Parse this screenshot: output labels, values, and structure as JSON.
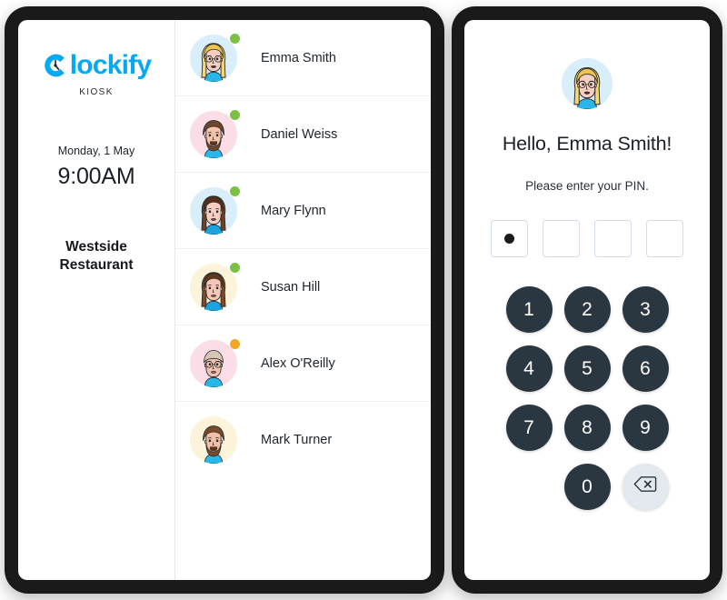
{
  "brand": {
    "name": "lockify",
    "logo_icon": "clockify-clock-logo-icon",
    "subtitle": "KIOSK",
    "accent_color": "#03A9F4"
  },
  "clock": {
    "date": "Monday, 1 May",
    "time": "9:00AM"
  },
  "location": {
    "name": "Westside Restaurant"
  },
  "status_colors": {
    "online": "#7ac143",
    "away": "#f5a623"
  },
  "users": [
    {
      "name": "Emma Smith",
      "status": "online",
      "avatar_icon": "avatar-emma-smith",
      "avatar_bg": "#d8eefb"
    },
    {
      "name": "Daniel Weiss",
      "status": "online",
      "avatar_icon": "avatar-daniel-weiss",
      "avatar_bg": "#fbdde7"
    },
    {
      "name": "Mary Flynn",
      "status": "online",
      "avatar_icon": "avatar-mary-flynn",
      "avatar_bg": "#d8eefb"
    },
    {
      "name": "Susan Hill",
      "status": "online",
      "avatar_icon": "avatar-susan-hill",
      "avatar_bg": "#fbf4da"
    },
    {
      "name": "Alex O'Reilly",
      "status": "away",
      "avatar_icon": "avatar-alex-oreilly",
      "avatar_bg": "#fbdde7"
    },
    {
      "name": "Mark Turner",
      "status": "none",
      "avatar_icon": "avatar-mark-turner",
      "avatar_bg": "#fbf4da"
    }
  ],
  "pin_panel": {
    "avatar_icon": "avatar-emma-smith",
    "avatar_bg": "#d8eefb",
    "greeting": "Hello, Emma Smith!",
    "prompt": "Please enter your PIN.",
    "pin_length": 4,
    "pin_filled": 1,
    "keypad": [
      {
        "label": "1",
        "name": "keypad-1"
      },
      {
        "label": "2",
        "name": "keypad-2"
      },
      {
        "label": "3",
        "name": "keypad-3"
      },
      {
        "label": "4",
        "name": "keypad-4"
      },
      {
        "label": "5",
        "name": "keypad-5"
      },
      {
        "label": "6",
        "name": "keypad-6"
      },
      {
        "label": "7",
        "name": "keypad-7"
      },
      {
        "label": "8",
        "name": "keypad-8"
      },
      {
        "label": "9",
        "name": "keypad-9"
      },
      {
        "label": "",
        "name": "keypad-blank"
      },
      {
        "label": "0",
        "name": "keypad-0"
      },
      {
        "label": "",
        "name": "keypad-backspace",
        "icon": "backspace-icon"
      }
    ]
  }
}
